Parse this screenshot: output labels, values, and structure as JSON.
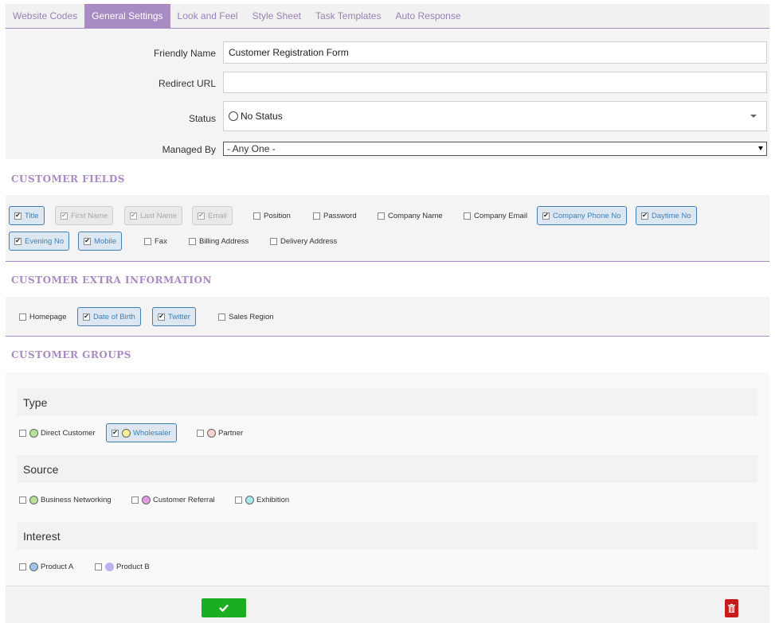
{
  "tabs": [
    {
      "label": "Website Codes"
    },
    {
      "label": "General Settings"
    },
    {
      "label": "Look and Feel"
    },
    {
      "label": "Style Sheet"
    },
    {
      "label": "Task Templates"
    },
    {
      "label": "Auto Response"
    }
  ],
  "form": {
    "friendly_name_label": "Friendly Name",
    "friendly_name_value": "Customer Registration Form",
    "redirect_label": "Redirect URL",
    "redirect_value": "",
    "status_label": "Status",
    "status_value": "No Status",
    "managed_label": "Managed By",
    "managed_value": "- Any One -"
  },
  "customer_fields": {
    "title": "CUSTOMER FIELDS",
    "items": [
      {
        "label": "Title",
        "state": "checked"
      },
      {
        "label": "First Name",
        "state": "disabled"
      },
      {
        "label": "Last Name",
        "state": "disabled"
      },
      {
        "label": "Email",
        "state": "disabled"
      },
      {
        "label": "Position",
        "state": "unchecked"
      },
      {
        "label": "Password",
        "state": "unchecked"
      },
      {
        "label": "Company Name",
        "state": "unchecked"
      },
      {
        "label": "Company Email",
        "state": "unchecked"
      },
      {
        "label": "Company Phone No",
        "state": "checked"
      },
      {
        "label": "Daytime No",
        "state": "checked"
      },
      {
        "label": "Evening No",
        "state": "checked"
      },
      {
        "label": "Mobile",
        "state": "checked"
      },
      {
        "label": "Fax",
        "state": "unchecked"
      },
      {
        "label": "Billing Address",
        "state": "unchecked"
      },
      {
        "label": "Delivery Address",
        "state": "unchecked"
      }
    ]
  },
  "extra_info": {
    "title": "CUSTOMER EXTRA INFORMATION",
    "items": [
      {
        "label": "Homepage",
        "state": "unchecked"
      },
      {
        "label": "Date of Birth",
        "state": "checked"
      },
      {
        "label": "Twitter",
        "state": "checked"
      },
      {
        "label": "Sales Region",
        "state": "unchecked"
      }
    ]
  },
  "groups": {
    "title": "CUSTOMER GROUPS",
    "type_title": "Type",
    "type_items": [
      {
        "label": "Direct Customer",
        "state": "unchecked",
        "color": "#b6e39a"
      },
      {
        "label": "Wholesaler",
        "state": "checked",
        "color": "#f5ef9a"
      },
      {
        "label": "Partner",
        "state": "unchecked",
        "color": "#f3d2cc"
      }
    ],
    "source_title": "Source",
    "source_items": [
      {
        "label": "Business Networking",
        "state": "unchecked",
        "color": "#b6e39a"
      },
      {
        "label": "Customer Referral",
        "state": "unchecked",
        "color": "#e59be0"
      },
      {
        "label": "Exhibition",
        "state": "unchecked",
        "color": "#a8e9ef"
      }
    ],
    "interest_title": "Interest",
    "interest_items": [
      {
        "label": "Product A",
        "state": "unchecked",
        "color": "#9cc7ec"
      },
      {
        "label": "Product B",
        "state": "unchecked",
        "color": "#b8b5f2"
      }
    ]
  },
  "colors": {
    "accent": "#a98bc4",
    "checked_border": "#3d7fb8",
    "save": "#1cae21",
    "delete": "#c81c1c"
  },
  "icons": {
    "save": "check-icon",
    "delete": "trash-icon"
  }
}
